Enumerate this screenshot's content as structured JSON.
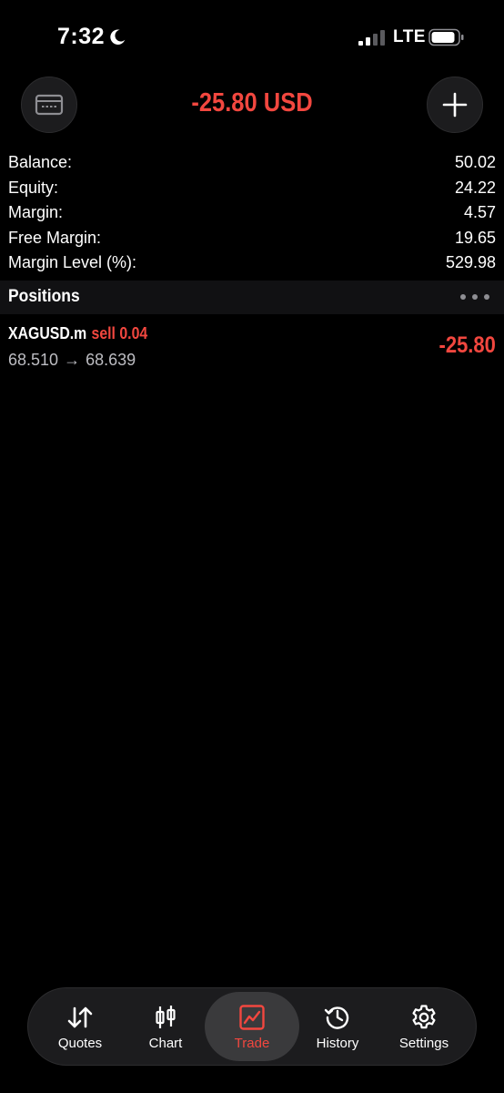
{
  "status_bar": {
    "time": "7:32",
    "network": "LTE"
  },
  "header": {
    "title": "-25.80 USD"
  },
  "summary": [
    {
      "label": "Balance:",
      "value": "50.02"
    },
    {
      "label": "Equity:",
      "value": "24.22"
    },
    {
      "label": "Margin:",
      "value": "4.57"
    },
    {
      "label": "Free Margin:",
      "value": "19.65"
    },
    {
      "label": "Margin Level (%):",
      "value": "529.98"
    }
  ],
  "positions": {
    "title": "Positions",
    "items": [
      {
        "symbol": "XAGUSD.m",
        "side": "sell",
        "volume": "0.04",
        "open_price": "68.510",
        "arrow": "→",
        "current_price": "68.639",
        "profit": "-25.80"
      }
    ]
  },
  "tabs": [
    {
      "label": "Quotes",
      "icon": "quotes-arrows-icon"
    },
    {
      "label": "Chart",
      "icon": "candlestick-icon"
    },
    {
      "label": "Trade",
      "icon": "trade-chart-icon",
      "active": true
    },
    {
      "label": "History",
      "icon": "history-clock-icon"
    },
    {
      "label": "Settings",
      "icon": "gear-icon"
    }
  ],
  "colors": {
    "accent_red": "#f2473f",
    "background": "#000000",
    "surface": "#1c1c1e"
  }
}
